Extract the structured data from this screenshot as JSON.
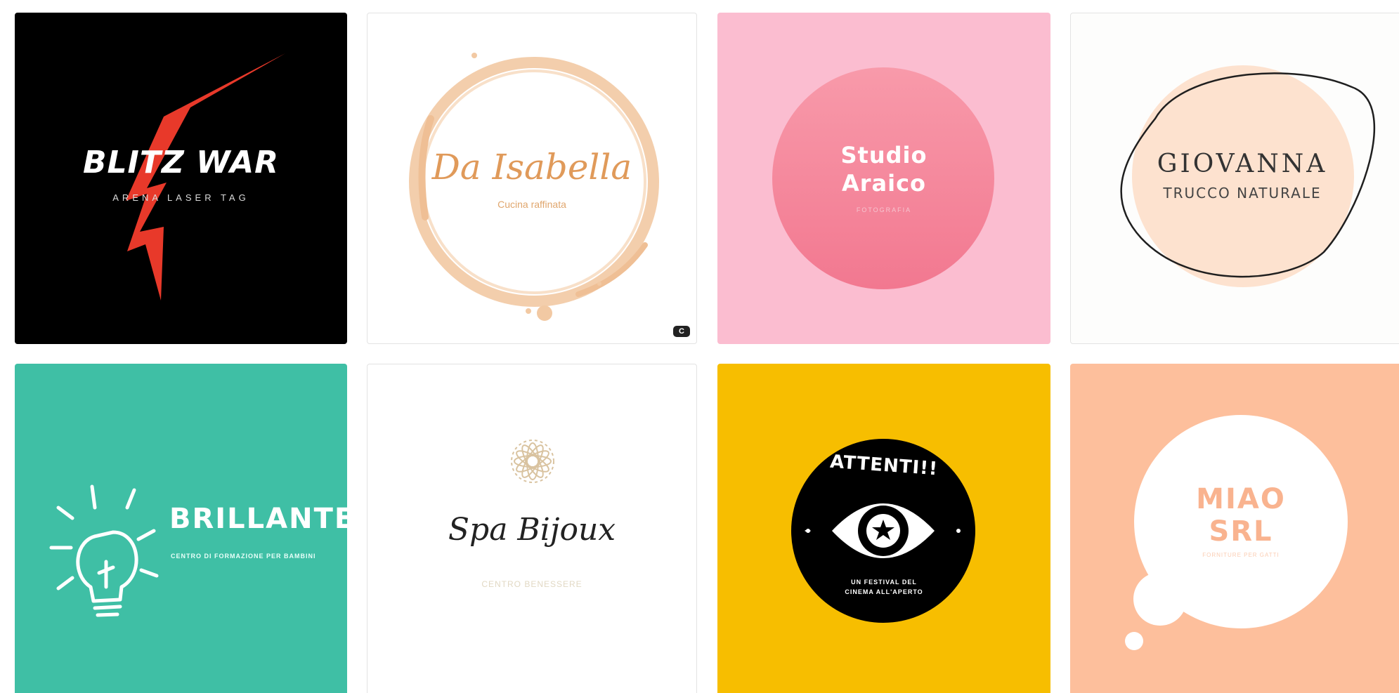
{
  "templates": [
    {
      "title": "BLITZ WAR",
      "subtitle": "ARENA LASER TAG",
      "background": "#000000",
      "accent": "#e8392a",
      "icon": "lightning-bolt-icon"
    },
    {
      "title": "Da Isabella",
      "subtitle": "Cucina raffinata",
      "background": "#ffffff",
      "accent": "#f2c9a3",
      "icon": "coffee-stain-ring-icon",
      "badge": "C"
    },
    {
      "title_line1": "Studio",
      "title_line2": "Araico",
      "subtitle": "FOTOGRAFIA",
      "background": "#fbbdd0",
      "accent": "#f58a9e"
    },
    {
      "title": "GIOVANNA",
      "subtitle": "TRUCCO NATURALE",
      "background": "#fdfdfc",
      "accent": "#fde2cf"
    },
    {
      "title": "BRILLANTE",
      "subtitle": "CENTRO DI FORMAZIONE PER BAMBINI",
      "background": "#3fbfa5",
      "icon": "lightbulb-icon"
    },
    {
      "title": "Spa Bijoux",
      "subtitle": "CENTRO BENESSERE",
      "background": "#ffffff",
      "accent": "#d9c3a0",
      "icon": "mandala-flower-icon"
    },
    {
      "title": "ATTENTI!!",
      "subtitle_line1": "UN FESTIVAL DEL",
      "subtitle_line2": "CINEMA ALL'APERTO",
      "background": "#f7be00",
      "icon": "eye-star-icon"
    },
    {
      "title_line1": "MIAO",
      "title_line2": "SRL",
      "subtitle": "FORNITURE PER GATTI",
      "background": "#fdbf9c",
      "accent": "#f9b38f",
      "icon": "speech-bubble-icon"
    }
  ]
}
